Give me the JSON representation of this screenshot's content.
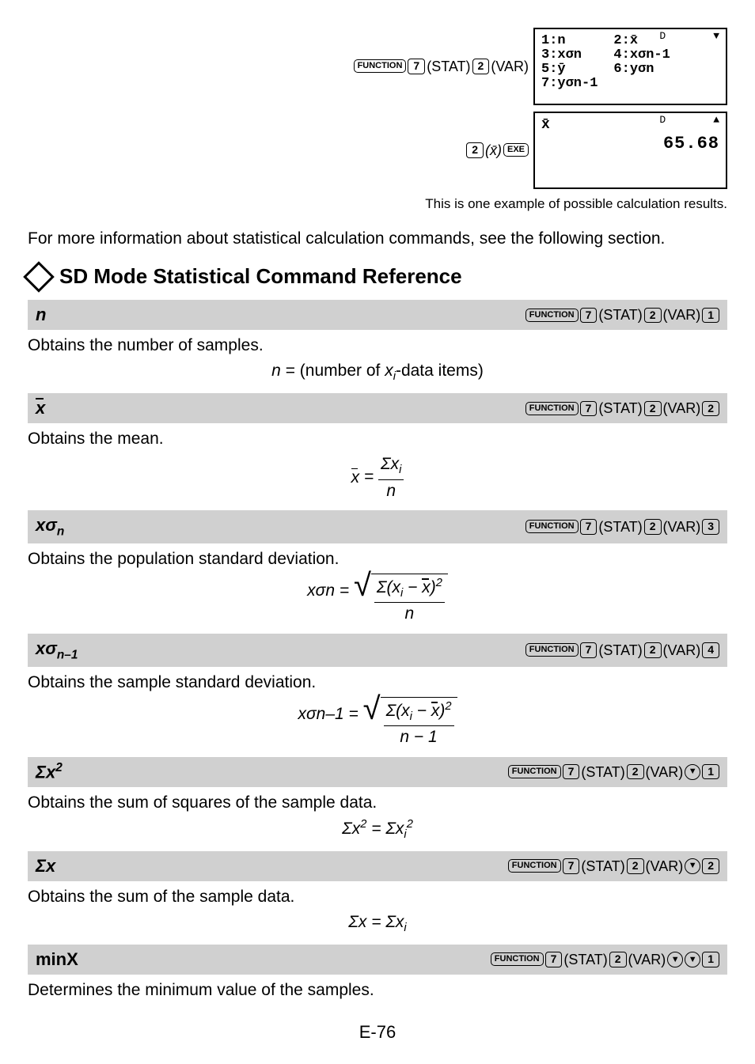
{
  "top": {
    "seq1_func": "FUNCTION",
    "seq1_k1": "7",
    "seq1_p1": "(STAT)",
    "seq1_k2": "2",
    "seq1_p2": "(VAR)",
    "lcd1": {
      "indicator": "D",
      "arrow": "▼",
      "left_lines": "1:n\n3:xσn\n5:ȳ\n7:yσn-1",
      "right_lines": "2:x̄\n4:xσn-1\n6:yσn"
    },
    "seq2_k": "2",
    "seq2_p": "(x̄)",
    "seq2_exe": "EXE",
    "lcd2": {
      "indicator": "D",
      "arrow": "▲",
      "label": "x̄",
      "value": "65.68"
    },
    "caption": "This is one example of possible calculation results."
  },
  "intro": "For more information about statistical calculation commands, see the following section.",
  "section_title": "SD Mode Statistical Command Reference",
  "kseq": {
    "func": "FUNCTION",
    "k7": "7",
    "stat": "(STAT)",
    "k2": "2",
    "var": "(VAR)",
    "k1": "1",
    "k3": "3",
    "k4": "4"
  },
  "cmds": [
    {
      "name": "n",
      "final": "1",
      "downs": 0,
      "desc": "Obtains the number of samples.",
      "formula_plain": "n = (number of xi-data items)"
    },
    {
      "name": "x̄",
      "final": "2",
      "downs": 0,
      "desc": "Obtains the mean."
    },
    {
      "name": "xσn",
      "final": "3",
      "downs": 0,
      "desc": "Obtains the population standard deviation."
    },
    {
      "name": "xσn–1",
      "final": "4",
      "downs": 0,
      "desc": "Obtains the sample standard deviation."
    },
    {
      "name": "Σx²",
      "final": "1",
      "downs": 1,
      "desc": "Obtains the sum of squares of the sample data."
    },
    {
      "name": "Σx",
      "final": "2",
      "downs": 1,
      "desc": "Obtains the sum of the sample data."
    },
    {
      "name": "minX",
      "final": "1",
      "downs": 2,
      "desc": "Determines the minimum value of the samples.",
      "upright": true
    }
  ],
  "page": "E-76"
}
